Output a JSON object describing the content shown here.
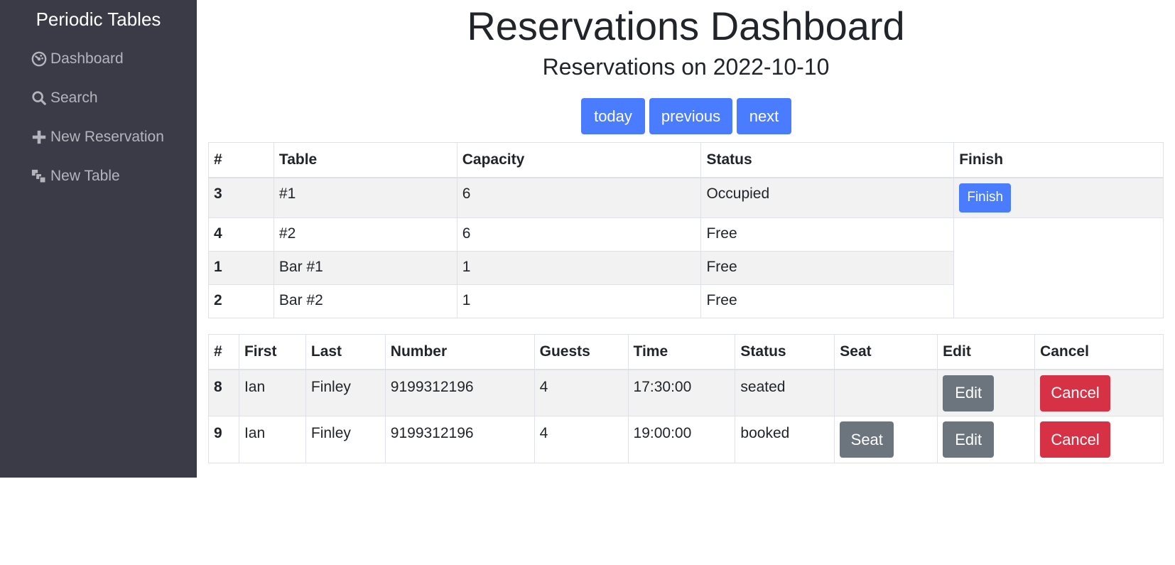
{
  "sidebar": {
    "brand": "Periodic Tables",
    "items": [
      {
        "label": "Dashboard",
        "icon": "dashboard-icon"
      },
      {
        "label": "Search",
        "icon": "search-icon"
      },
      {
        "label": "New Reservation",
        "icon": "plus-icon"
      },
      {
        "label": "New Table",
        "icon": "layers-icon"
      }
    ]
  },
  "header": {
    "title": "Reservations Dashboard",
    "subtitle": "Reservations on 2022-10-10"
  },
  "date_nav": {
    "today": "today",
    "previous": "previous",
    "next": "next"
  },
  "tables_table": {
    "headers": [
      "#",
      "Table",
      "Capacity",
      "Status",
      "Finish"
    ],
    "rows": [
      {
        "id": "3",
        "name": "#1",
        "capacity": "6",
        "status": "Occupied",
        "finish": "Finish"
      },
      {
        "id": "4",
        "name": "#2",
        "capacity": "6",
        "status": "Free"
      },
      {
        "id": "1",
        "name": "Bar #1",
        "capacity": "1",
        "status": "Free"
      },
      {
        "id": "2",
        "name": "Bar #2",
        "capacity": "1",
        "status": "Free"
      }
    ]
  },
  "reservations_table": {
    "headers": [
      "#",
      "First",
      "Last",
      "Number",
      "Guests",
      "Time",
      "Status",
      "Seat",
      "Edit",
      "Cancel"
    ],
    "rows": [
      {
        "id": "8",
        "first": "Ian",
        "last": "Finley",
        "number": "9199312196",
        "guests": "4",
        "time": "17:30:00",
        "status": "seated",
        "edit": "Edit",
        "cancel": "Cancel"
      },
      {
        "id": "9",
        "first": "Ian",
        "last": "Finley",
        "number": "9199312196",
        "guests": "4",
        "time": "19:00:00",
        "status": "booked",
        "seat": "Seat",
        "edit": "Edit",
        "cancel": "Cancel"
      }
    ]
  },
  "colors": {
    "sidebar_bg": "#3b3b48",
    "primary": "#4a7cff",
    "secondary": "#6c757d",
    "danger": "#d63144"
  }
}
